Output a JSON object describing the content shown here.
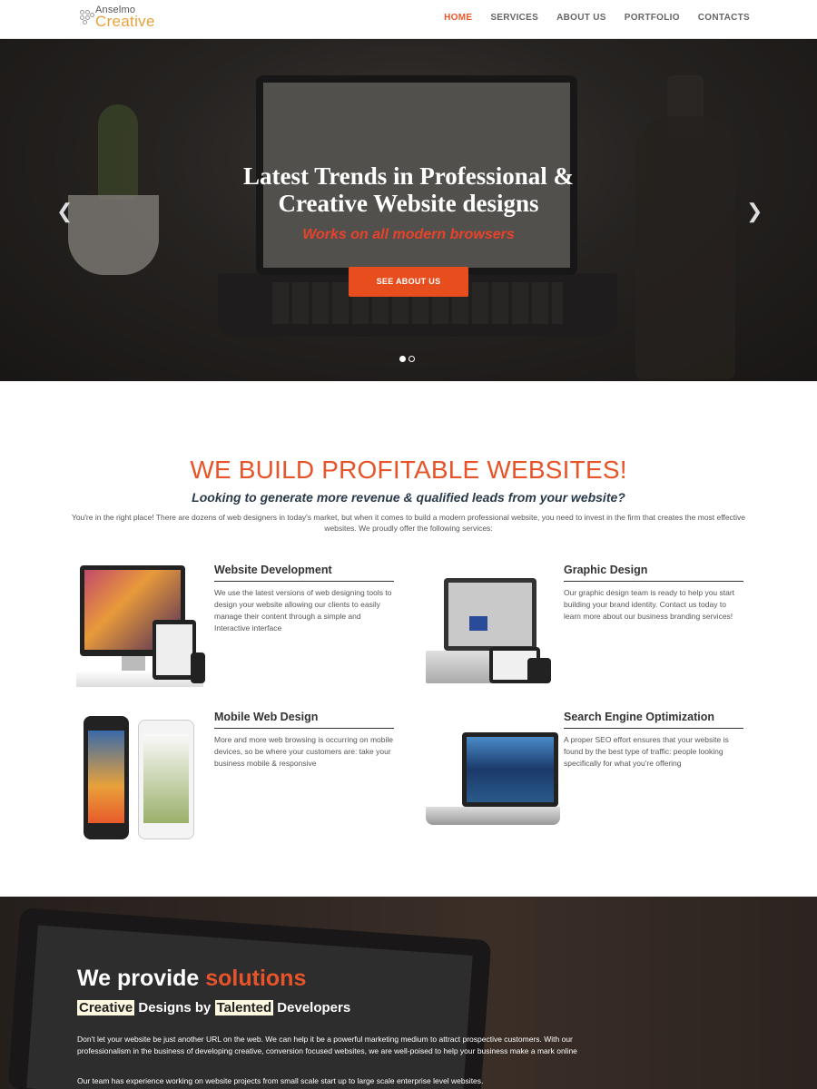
{
  "header": {
    "logo_top": "Anselmo",
    "logo_main": "Creative",
    "nav": [
      {
        "label": "HOME",
        "active": true
      },
      {
        "label": "SERVICES"
      },
      {
        "label": "ABOUT US"
      },
      {
        "label": "PORTFOLIO"
      },
      {
        "label": "CONTACTS"
      }
    ]
  },
  "hero": {
    "title_line1": "Latest Trends in Professional &",
    "title_line2": "Creative Website designs",
    "subtitle": "Works on all modern browsers",
    "button": "SEE ABOUT US",
    "slides": 2,
    "active_slide": 1
  },
  "services_section": {
    "title": "WE BUILD PROFITABLE WEBSITES!",
    "subtitle": "Looking to generate more revenue & qualified leads from your website?",
    "intro": "You're in the right place! There are dozens of web designers in today's market, but when it comes to build a modern professional website, you need to invest in the firm that creates the most effective websites. We proudly offer the following services:",
    "items": [
      {
        "title": "Website Development",
        "text": "We use the latest versions of web designing tools to design your website allowing our clients to easily manage their content through a simple and Interactive interface"
      },
      {
        "title": "Graphic Design",
        "text": "Our graphic design team is ready to help you start building your brand identity. Contact us today to learn more about our business branding services!"
      },
      {
        "title": "Mobile Web Design",
        "text": "More and more web browsing is occurring on mobile devices, so be where your customers are: take your business mobile & responsive"
      },
      {
        "title": "Search Engine Optimization",
        "text": "A proper SEO effort ensures that your website is found by the best type of traffic: people looking specifically for what you're offering"
      }
    ]
  },
  "solutions": {
    "title_plain": "We provide ",
    "title_accent": "solutions",
    "sub_word1": "Creative",
    "sub_mid": " Designs by ",
    "sub_word2": "Talented",
    "sub_end": " Developers",
    "para1": "Don't let your website be just another URL on the web. We can help it be a powerful marketing medium to attract prospective customers. With our professionalism in the business of developing creative, conversion focused websites, we are well-poised to help your business make a mark online",
    "para2": "Our team has experience working on website projects from small scale start up to large scale enterprise level websites."
  }
}
